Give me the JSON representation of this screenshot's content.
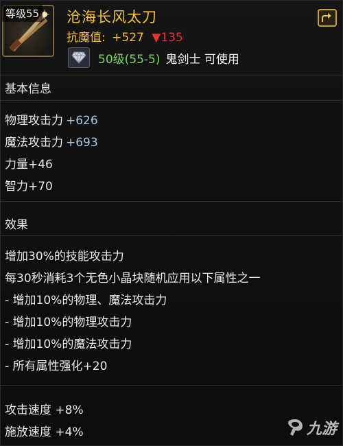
{
  "item": {
    "level_badge": "等级55",
    "name": "沧海长风太刀",
    "resist_label": "抗魔值:",
    "resist_value": "+527",
    "resist_diff": "▼135",
    "requirement_level": "50级(55-5)",
    "requirement_class": "鬼剑士 可使用",
    "icon": "katana-icon",
    "gem_icon": "diamond-icon",
    "share_icon": "share-icon"
  },
  "basic_info": {
    "title": "基本信息",
    "stats": [
      {
        "label": "物理攻击力",
        "value": "+626"
      },
      {
        "label": "魔法攻击力",
        "value": "+693"
      },
      {
        "label": "力量",
        "value": "+46"
      },
      {
        "label": "智力",
        "value": "+70"
      }
    ]
  },
  "effects": {
    "title": "效果",
    "lines": [
      "增加30%的技能攻击力",
      "每30秒消耗3个无色小晶块随机应用以下属性之一",
      "- 增加10%的物理、魔法攻击力",
      "- 增加10%的物理攻击力",
      "- 增加10%的魔法攻击力",
      "- 所有属性强化+20"
    ]
  },
  "speed": {
    "lines": [
      "攻击速度 +8%",
      "施放速度 +4%"
    ]
  },
  "watermark": {
    "text": "九游",
    "icon": "jiuyou-logo-icon"
  },
  "colors": {
    "gold": "#f2c230",
    "red": "#e53535",
    "green": "#7ed957",
    "blue_value": "#a9c8e8"
  }
}
